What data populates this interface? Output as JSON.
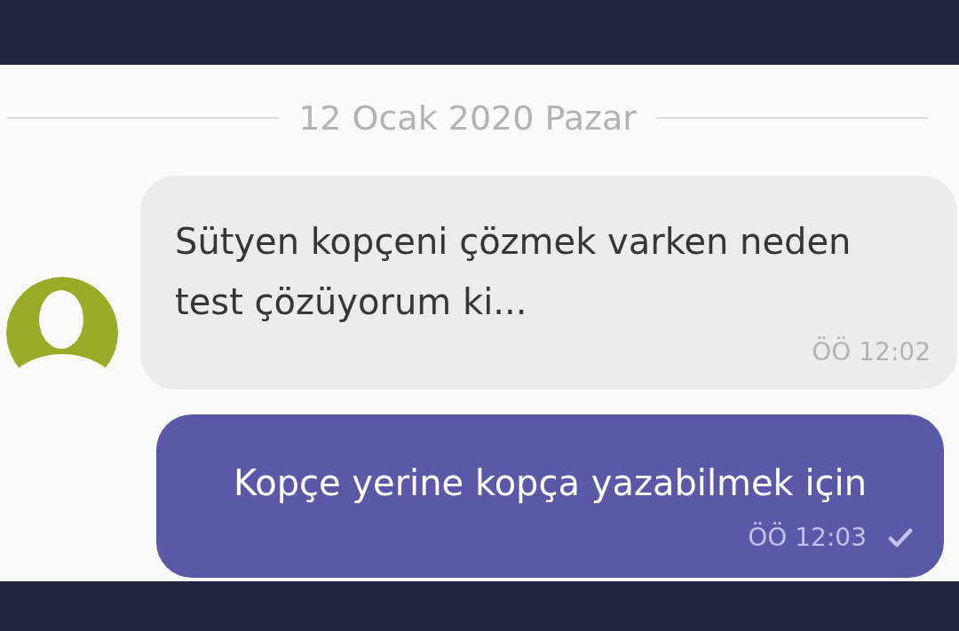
{
  "date_separator": "12 Ocak 2020 Pazar",
  "messages": [
    {
      "kind": "incoming",
      "text": "Sütyen kopçeni çözmek varken neden test çözüyorum ki...",
      "time": "ÖÖ 12:02"
    },
    {
      "kind": "outgoing",
      "text": "Kopçe yerine kopça yazabilmek için",
      "time": "ÖÖ 12:03",
      "sent": true
    }
  ]
}
